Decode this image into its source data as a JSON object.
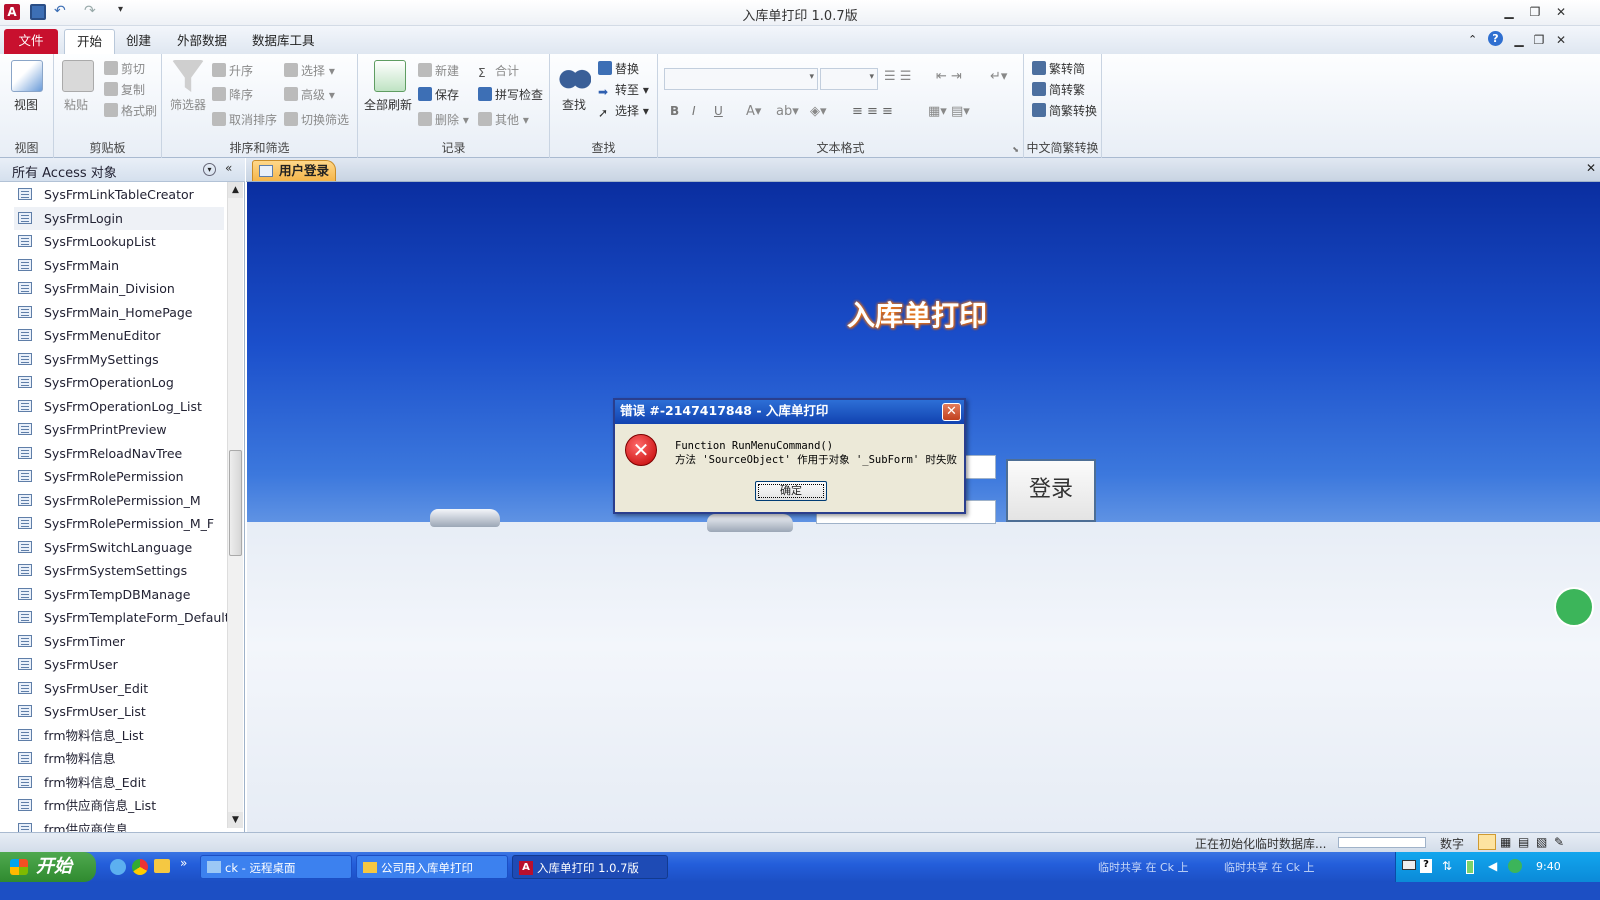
{
  "window": {
    "title": "入库单打印 1.0.7版"
  },
  "ribbon": {
    "tabs": [
      "文件",
      "开始",
      "创建",
      "外部数据",
      "数据库工具"
    ],
    "groups": {
      "view": {
        "label": "视图",
        "btn": "视图"
      },
      "clipboard": {
        "label": "剪贴板",
        "paste": "粘贴",
        "cut": "剪切",
        "copy": "复制",
        "format": "格式刷"
      },
      "sort": {
        "label": "排序和筛选",
        "filter": "筛选器",
        "asc": "升序",
        "desc": "降序",
        "clear": "取消排序",
        "select": "选择",
        "advanced": "高级",
        "toggle": "切换筛选"
      },
      "records": {
        "label": "记录",
        "refresh": "全部刷新",
        "new": "新建",
        "save": "保存",
        "delete": "删除",
        "total": "合计",
        "spell": "拼写检查",
        "other": "其他"
      },
      "find": {
        "label": "查找",
        "find": "查找",
        "replace": "替换",
        "goto": "转至",
        "select": "选择"
      },
      "text": {
        "label": "文本格式",
        "bold": "B",
        "italic": "I",
        "underline": "U"
      },
      "chinese": {
        "label": "中文简繁转换",
        "t2s": "繁转简",
        "s2t": "简转繁",
        "convert": "简繁转换"
      }
    }
  },
  "nav": {
    "header": "所有 Access 对象",
    "items": [
      "SysFrmLinkTableCreator",
      "SysFrmLogin",
      "SysFrmLookupList",
      "SysFrmMain",
      "SysFrmMain_Division",
      "SysFrmMain_HomePage",
      "SysFrmMenuEditor",
      "SysFrmMySettings",
      "SysFrmOperationLog",
      "SysFrmOperationLog_List",
      "SysFrmPrintPreview",
      "SysFrmReloadNavTree",
      "SysFrmRolePermission",
      "SysFrmRolePermission_M",
      "SysFrmRolePermission_M_F",
      "SysFrmSwitchLanguage",
      "SysFrmSystemSettings",
      "SysFrmTempDBManage",
      "SysFrmTemplateForm_Default",
      "SysFrmTimer",
      "SysFrmUser",
      "SysFrmUser_Edit",
      "SysFrmUser_List",
      "frm物料信息_List",
      "frm物料信息",
      "frm物料信息_Edit",
      "frm供应商信息_List",
      "frm供应商信息"
    ]
  },
  "document": {
    "tab": "用户登录",
    "app_title": "入库单打印",
    "login_button": "登录"
  },
  "dialog": {
    "title": "错误 #-2147417848 - 入库单打印",
    "line1": "Function RunMenuCommand()",
    "line2": "方法 'SourceObject' 作用于对象 '_SubForm' 时失败",
    "ok": "确定"
  },
  "status": {
    "message": "正在初始化临时数据库...",
    "mode": "数字"
  },
  "taskbar": {
    "start": "开始",
    "tasks": [
      "ck - 远程桌面",
      "公司用入库单打印",
      "入库单打印 1.0.7版"
    ],
    "ime1": "临时共享 在 Ck 上",
    "ime2": "临时共享 在 Ck 上",
    "clock": "9:40"
  },
  "colors": {
    "file_tab": "#c8102e",
    "title_glow": "#f07a18",
    "dialog_title": "#1142b0",
    "taskbar": "#245edb"
  }
}
